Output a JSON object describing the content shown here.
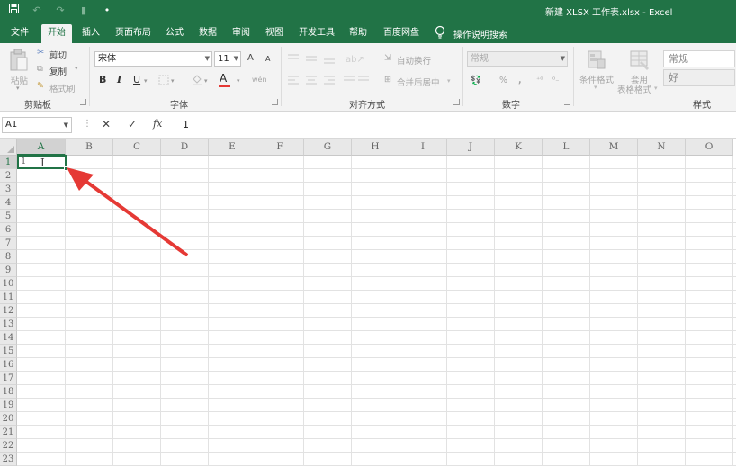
{
  "window": {
    "title": "新建 XLSX 工作表.xlsx  -  Excel"
  },
  "quick_access": {
    "save_icon": "save-icon",
    "undo_icon": "undo-icon",
    "redo_icon": "redo-icon",
    "touch_icon": "touch-mode-icon",
    "customize": "•"
  },
  "tabs": [
    "文件",
    "开始",
    "插入",
    "页面布局",
    "公式",
    "数据",
    "审阅",
    "视图",
    "开发工具",
    "帮助",
    "百度网盘"
  ],
  "active_tab": "开始",
  "tell_me": "操作说明搜索",
  "ribbon": {
    "clipboard": {
      "paste": "粘贴",
      "cut": "剪切",
      "copy": "复制",
      "format_painter": "格式刷",
      "label": "剪贴板"
    },
    "font": {
      "name": "宋体",
      "size": "11",
      "grow": "A",
      "shrink": "A",
      "bold": "B",
      "italic": "I",
      "underline": "U",
      "font_color": "A",
      "phonetic": "wén",
      "label": "字体"
    },
    "alignment": {
      "wrap_text": "自动换行",
      "merge_center": "合并后居中",
      "label": "对齐方式"
    },
    "number": {
      "format": "常规",
      "percent": "%",
      "comma": ",",
      "label": "数字"
    },
    "styles": {
      "conditional": "条件格式",
      "table_line1": "套用",
      "table_line2": "表格格式",
      "normal": "常规",
      "good": "好",
      "label": "样式"
    }
  },
  "formula_bar": {
    "name_box": "A1",
    "cancel": "✕",
    "enter": "✓",
    "fx": "fx",
    "value": "1"
  },
  "sheet": {
    "columns": [
      "A",
      "B",
      "C",
      "D",
      "E",
      "F",
      "G",
      "H",
      "I",
      "J",
      "K",
      "L",
      "M",
      "N",
      "O"
    ],
    "rows": [
      "1",
      "2",
      "3",
      "4",
      "5",
      "6",
      "7",
      "8",
      "9",
      "10",
      "11",
      "12",
      "13",
      "14",
      "15",
      "16",
      "17",
      "18",
      "19",
      "20",
      "21",
      "22",
      "23"
    ],
    "active_cell": "A1",
    "active_value": "1"
  },
  "colors": {
    "accent": "#217346",
    "arrow": "#e53935"
  }
}
